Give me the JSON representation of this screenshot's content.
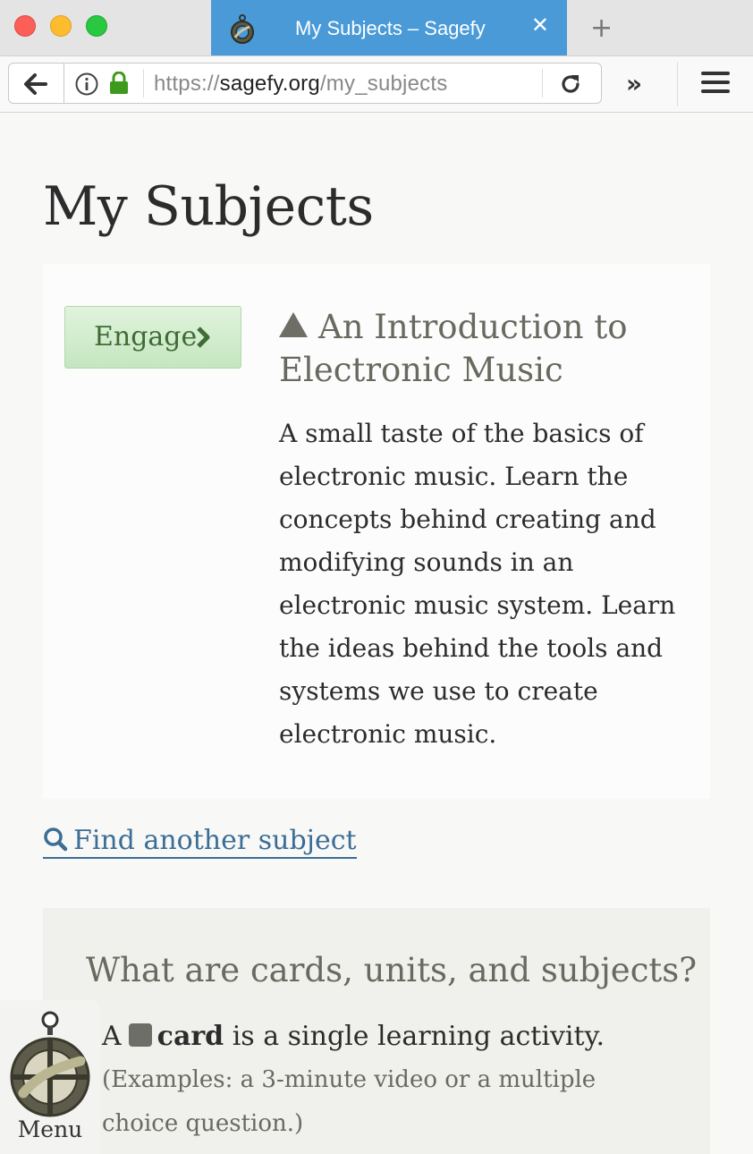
{
  "browser": {
    "tab_title": "My Subjects – Sagefy",
    "tab_close": "✕",
    "new_tab": "+",
    "url_scheme": "https://",
    "url_host": "sagefy.org",
    "url_path": "/my_subjects",
    "overflow": "»"
  },
  "page": {
    "title": "My Subjects"
  },
  "subject": {
    "engage_label": "Engage",
    "name": "An Introduction to Electronic Music",
    "description": "A small taste of the basics of electronic music. Learn the concepts behind creating and modifying sounds in an electronic music system. Learn the ideas behind the tools and systems we use to create electronic music."
  },
  "find_link": "Find another subject",
  "help": {
    "title": "What are cards, units, and subjects?",
    "items": [
      {
        "prefix": "A",
        "term": "card",
        "rest": " is a single learning activity.",
        "example": "(Examples: a 3-minute video or a multiple choice question.)"
      }
    ]
  },
  "menu": {
    "label": "Menu"
  }
}
